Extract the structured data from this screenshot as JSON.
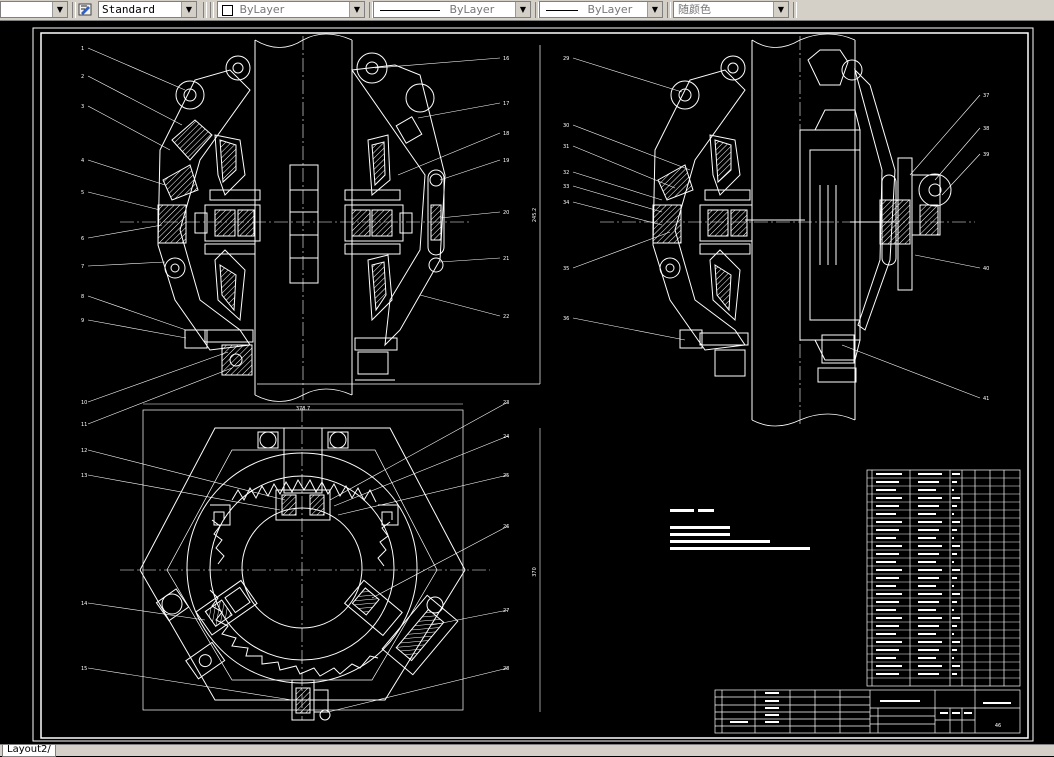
{
  "toolbar": {
    "text_style": "Standard",
    "layer_color": "ByLayer",
    "linetype": "ByLayer",
    "lineweight": "ByLayer",
    "plot_style": "随颜色"
  },
  "drawing": {
    "dim_horizontal": "378.7",
    "dim_vertical_right": "245.2",
    "dim_vertical_bottom": "370",
    "title_block_number": "46"
  },
  "callouts_left": [
    "1",
    "2",
    "3",
    "4",
    "5",
    "6",
    "7",
    "8",
    "9",
    "10",
    "11",
    "12",
    "13",
    "14",
    "15"
  ],
  "callouts_mid": [
    "16",
    "17",
    "18",
    "19",
    "20",
    "21",
    "22",
    "23",
    "24",
    "25",
    "26",
    "27",
    "28"
  ],
  "callouts_right": [
    "29",
    "30",
    "31",
    "32",
    "33",
    "34",
    "35",
    "36",
    "37",
    "38",
    "39",
    "40",
    "41"
  ],
  "layout_tab": "Layout2"
}
